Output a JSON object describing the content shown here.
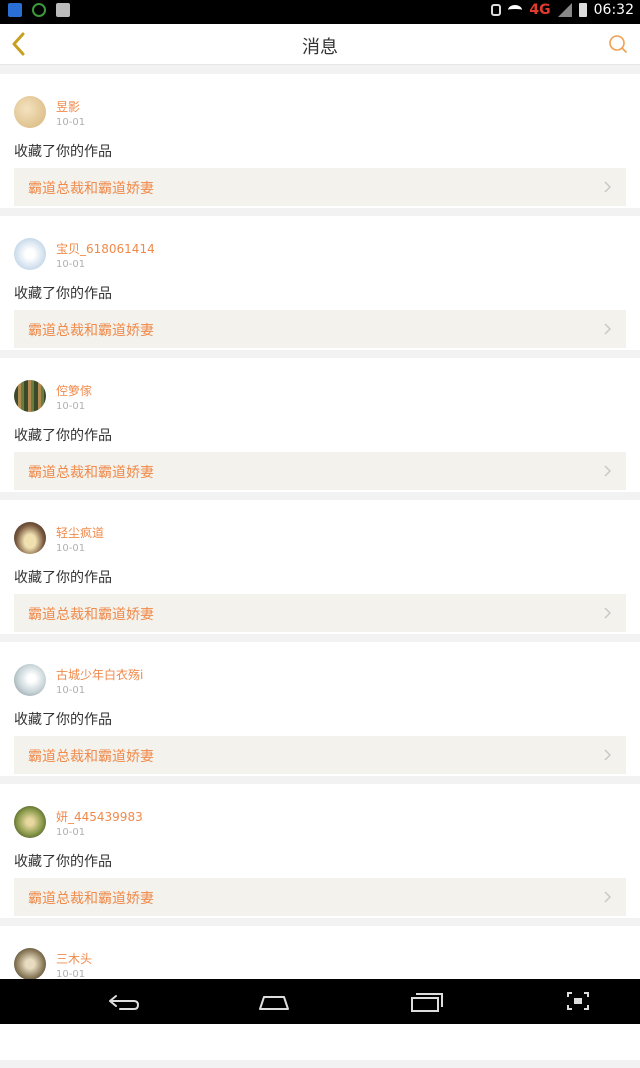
{
  "status_bar": {
    "network": "4G",
    "time": "06:32",
    "icons": [
      "app-notification-icon",
      "sync-icon",
      "image-icon",
      "mute-icon",
      "wifi-icon",
      "signal-icon",
      "battery-icon"
    ]
  },
  "header": {
    "title": "消息",
    "back_icon": "chevron-left-icon",
    "search_icon": "search-icon",
    "accent": "#f08a4b"
  },
  "messages": [
    {
      "name": "昱影",
      "time": "10-01",
      "action": "收藏了你的作品",
      "work": "霸道总裁和霸道娇妻",
      "avatar_color": "#d7b47a"
    },
    {
      "name": "宝贝_618061414",
      "time": "10-01",
      "action": "收藏了你的作品",
      "work": "霸道总裁和霸道娇妻",
      "avatar_color": "#c9daea"
    },
    {
      "name": "倥箩傢",
      "time": "10-01",
      "action": "收藏了你的作品",
      "work": "霸道总裁和霸道娇妻",
      "avatar_color": "#5a6e3c"
    },
    {
      "name": "轻尘疯道",
      "time": "10-01",
      "action": "收藏了你的作品",
      "work": "霸道总裁和霸道娇妻",
      "avatar_color": "#7a5a40"
    },
    {
      "name": "古城少年白衣殇i",
      "time": "10-01",
      "action": "收藏了你的作品",
      "work": "霸道总裁和霸道娇妻",
      "avatar_color": "#c8d4d8"
    },
    {
      "name": "妍_445439983",
      "time": "10-01",
      "action": "收藏了你的作品",
      "work": "霸道总裁和霸道娇妻",
      "avatar_color": "#8a9a4a"
    },
    {
      "name": "三木头",
      "time": "10-01",
      "action": "",
      "work": "",
      "avatar_color": "#8a7a5a"
    }
  ],
  "nav_bar": {
    "icons": [
      "back-nav-icon",
      "home-nav-icon",
      "recents-nav-icon",
      "screenshot-nav-icon"
    ]
  }
}
